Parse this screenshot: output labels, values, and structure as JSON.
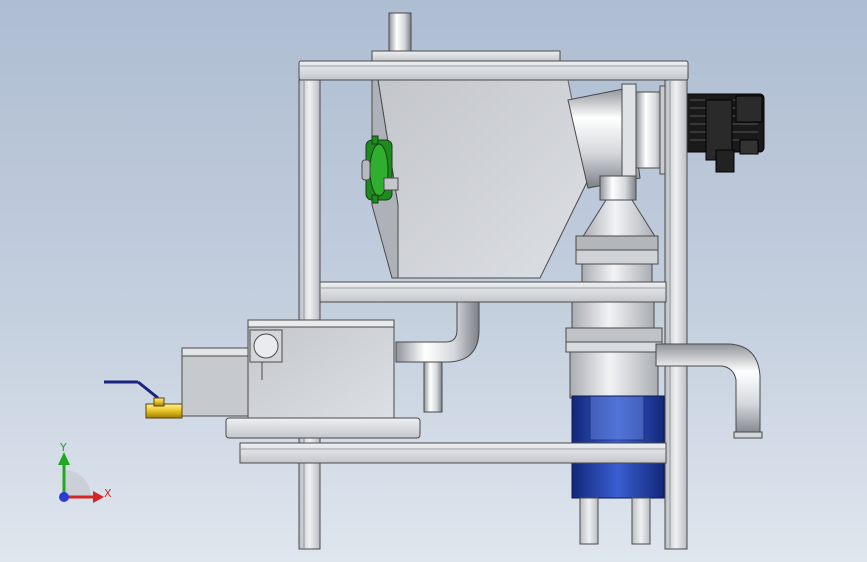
{
  "triad": {
    "y_label": "Y",
    "x_label": "X",
    "y_color": "#21a821",
    "x_color": "#d42626",
    "z_color": "#2a3cd8"
  },
  "colors": {
    "frame": "#d6d9de",
    "frame_edge": "#4a4a4a",
    "housing": "#cfd2d7",
    "motor": "#1e3eb4",
    "sprocket": "#1f8a1f",
    "gearmotor": "#1a1a1a",
    "valve": "#e6c21e",
    "valve_handle": "#1a237e"
  },
  "parts": [
    "inlet-pipe",
    "top-frame-rail",
    "screw-housing",
    "drive-sprocket",
    "discharge-elbow",
    "gear-motor",
    "flanged-hopper",
    "middle-frame-rail",
    "drain-elbow",
    "cyclone-chamber",
    "blower-motor",
    "outlet-elbow",
    "settling-tank",
    "ball-valve",
    "base-frame-rail"
  ]
}
